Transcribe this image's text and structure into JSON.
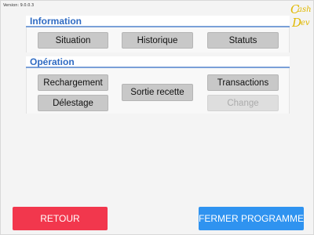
{
  "app": {
    "version_text": "Version: 9.0.0.3",
    "logo_text_top": "ash",
    "logo_text_bottom": "ev",
    "logo_initial_top": "C",
    "logo_initial_bottom": "D"
  },
  "information": {
    "title": "Information",
    "buttons": {
      "situation": "Situation",
      "historique": "Historique",
      "statuts": "Statuts"
    }
  },
  "operation": {
    "title": "Opération",
    "buttons": {
      "rechargement": "Rechargement",
      "delestage": "Délestage",
      "sortie_recette": "Sortie recette",
      "transactions": "Transactions",
      "change": "Change"
    },
    "change_enabled": false
  },
  "footer": {
    "retour": "RETOUR",
    "fermer": "FERMER PROGRAMME"
  },
  "colors": {
    "accent": "#2f6bc3",
    "retour_bg": "#f2374d",
    "fermer_bg": "#2f93f0",
    "logo": "#e0b800"
  }
}
